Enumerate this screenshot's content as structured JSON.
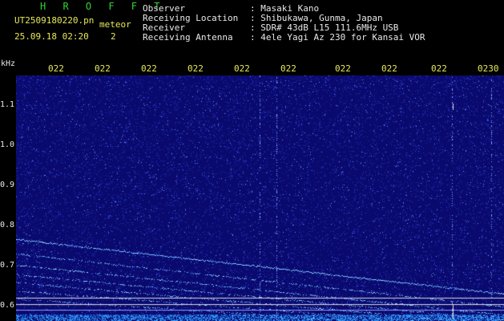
{
  "header": {
    "app_name": "H R O F F T",
    "filename": "UT2509180220.pn",
    "mode": "meteor",
    "datetime": "25.09.18 02:20",
    "page": "2",
    "observer_label": "Observer",
    "observer_value": ": Masaki Kano",
    "location_label": "Receiving Location",
    "location_value": ": Shibukawa, Gunma, Japan",
    "receiver_label": "Receiver",
    "receiver_value": ": SDR# 43dB L15 111.6MHz USB",
    "antenna_label": "Receiving Antenna",
    "antenna_value": ": 4ele Yagi Az 230 for Kansai VOR"
  },
  "spectrogram": {
    "y_unit": "kHz",
    "y_ticks": [
      "1.1",
      "1.0",
      "0.9",
      "0.8",
      "0.7",
      "0.6"
    ],
    "x_ticks": [
      "022",
      "022",
      "022",
      "022",
      "022",
      "022",
      "022",
      "022",
      "022",
      "0230"
    ],
    "colors": {
      "background": "#0a0a6e",
      "noise": "#2a3cd8",
      "signal": "#9ad8ff",
      "text": "#e8e85a"
    }
  }
}
